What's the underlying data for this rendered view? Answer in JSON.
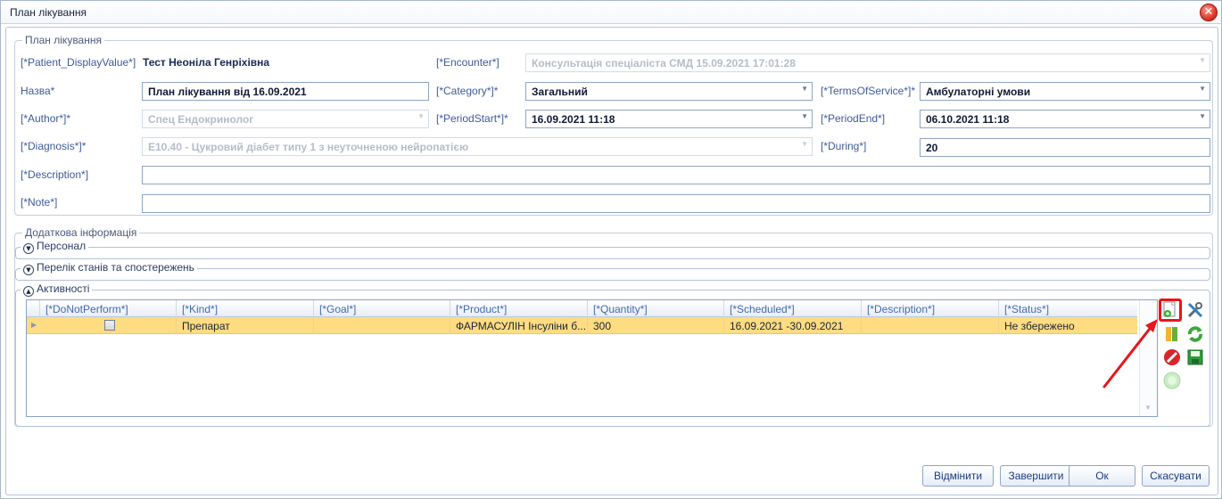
{
  "window": {
    "title": "План лікування"
  },
  "plan": {
    "legend": "План лікування",
    "patient": {
      "label": "[*Patient_DisplayValue*]",
      "value": "Тест Неоніла Генріхівна"
    },
    "encounter": {
      "label": "[*Encounter*]",
      "value": "Консультація спеціаліста СМД 15.09.2021 17:01:28"
    },
    "name": {
      "label": "Назва*",
      "value": "План лікування від 16.09.2021"
    },
    "category": {
      "label": "[*Category*]*",
      "value": "Загальний"
    },
    "terms": {
      "label": "[*TermsOfService*]*",
      "value": "Амбулаторні умови"
    },
    "author": {
      "label": "[*Author*]*",
      "value": "Спец Ендокринолог"
    },
    "period_start": {
      "label": "[*PeriodStart*]*",
      "value": "16.09.2021 11:18"
    },
    "period_end": {
      "label": "[*PeriodEnd*]",
      "value": "06.10.2021 11:18"
    },
    "diagnosis": {
      "label": "[*Diagnosis*]*",
      "value": "E10.40 - Цукровий діабет типу 1 з неуточненою нейропатією"
    },
    "during": {
      "label": "[*During*]",
      "value": "20"
    },
    "description": {
      "label": "[*Description*]",
      "value": ""
    },
    "note": {
      "label": "[*Note*]",
      "value": ""
    }
  },
  "additional": {
    "legend": "Додаткова інформація",
    "personnel": "Персонал",
    "conditions": "Перелік станів та спостережень",
    "activities": "Активності"
  },
  "grid": {
    "columns": [
      "[*DoNotPerform*]",
      "[*Kind*]",
      "[*Goal*]",
      "[*Product*]",
      "[*Quantity*]",
      "[*Scheduled*]",
      "[*Description*]",
      "[*Status*]"
    ],
    "rows": [
      {
        "kind": "Препарат",
        "goal": "",
        "product": "ФАРМАСУЛІН Інсуліни б...",
        "quantity": "300",
        "scheduled": "16.09.2021 -30.09.2021",
        "description": "",
        "status": "Не збережено",
        "do_not_perform": false
      }
    ]
  },
  "toolbar_icons": [
    "add-icon",
    "settings-icon",
    "flag-icon",
    "refresh-icon",
    "delete-icon",
    "save-icon",
    "confirm-icon"
  ],
  "buttons": {
    "undo": "Відмінити",
    "finish": "Завершити",
    "ok": "Ок",
    "cancel": "Скасувати"
  },
  "colors": {
    "selected_row": "#fedc82",
    "highlight": "#e8151b",
    "label": "#3d5a9c"
  }
}
